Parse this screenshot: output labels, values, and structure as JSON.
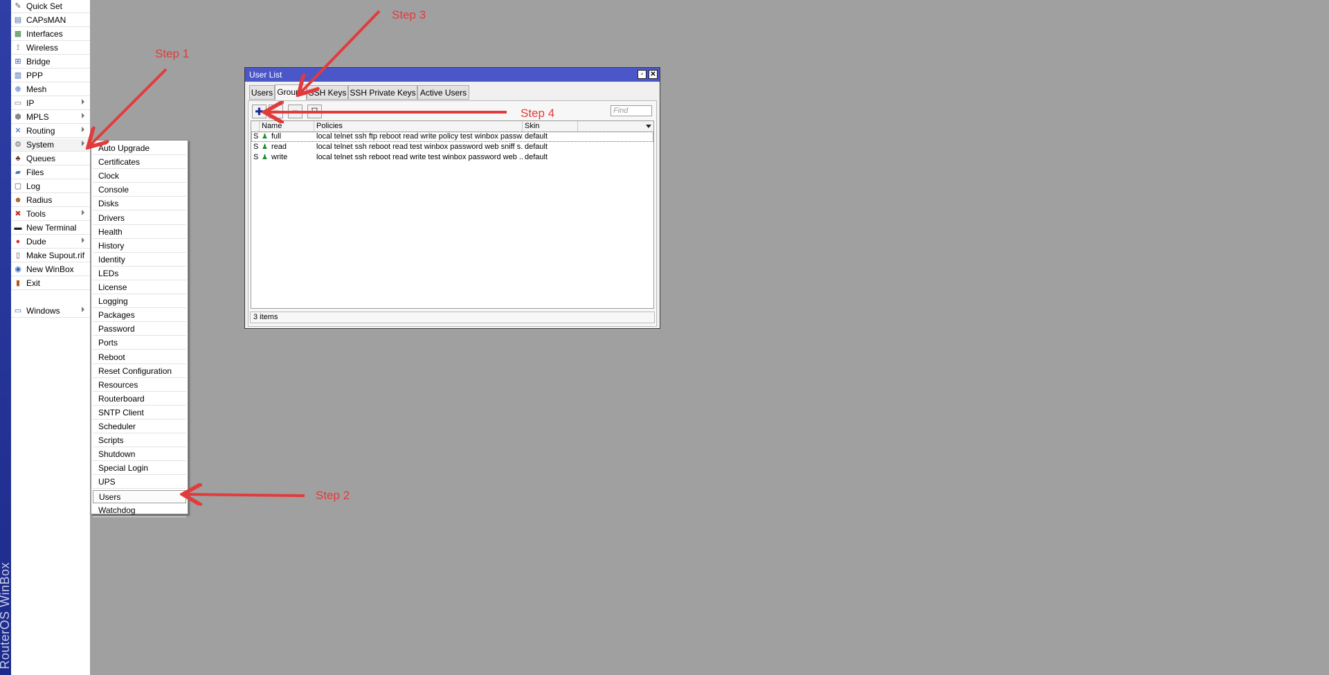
{
  "brand": "RouterOS WinBox",
  "side_menu": [
    {
      "label": "Quick Set",
      "icon": "magic-wand-icon",
      "glyph": "✎",
      "color": "#555",
      "arrow": false
    },
    {
      "label": "CAPsMAN",
      "icon": "capsman-icon",
      "glyph": "▤",
      "color": "#4a6aa8",
      "arrow": false
    },
    {
      "label": "Interfaces",
      "icon": "interfaces-icon",
      "glyph": "▦",
      "color": "#2d7a2d",
      "arrow": false
    },
    {
      "label": "Wireless",
      "icon": "wireless-icon",
      "glyph": "⟟",
      "color": "#555",
      "arrow": false
    },
    {
      "label": "Bridge",
      "icon": "bridge-icon",
      "glyph": "⊞",
      "color": "#2f5fb0",
      "arrow": false
    },
    {
      "label": "PPP",
      "icon": "ppp-icon",
      "glyph": "▥",
      "color": "#2f5fb0",
      "arrow": false
    },
    {
      "label": "Mesh",
      "icon": "mesh-icon",
      "glyph": "⊕",
      "color": "#2f5fb0",
      "arrow": false
    },
    {
      "label": "IP",
      "icon": "ip-icon",
      "glyph": "▭",
      "color": "#777",
      "arrow": true
    },
    {
      "label": "MPLS",
      "icon": "mpls-icon",
      "glyph": "⬢",
      "color": "#888",
      "arrow": true
    },
    {
      "label": "Routing",
      "icon": "routing-icon",
      "glyph": "✕",
      "color": "#2f5fb0",
      "arrow": true
    },
    {
      "label": "System",
      "icon": "system-gear-icon",
      "glyph": "⚙",
      "color": "#666",
      "arrow": true
    },
    {
      "label": "Queues",
      "icon": "queues-icon",
      "glyph": "♣",
      "color": "#5a3b2a",
      "arrow": false
    },
    {
      "label": "Files",
      "icon": "files-folder-icon",
      "glyph": "▰",
      "color": "#4a78c0",
      "arrow": false
    },
    {
      "label": "Log",
      "icon": "log-icon",
      "glyph": "▢",
      "color": "#555",
      "arrow": false
    },
    {
      "label": "Radius",
      "icon": "radius-users-icon",
      "glyph": "☻",
      "color": "#a06020",
      "arrow": false
    },
    {
      "label": "Tools",
      "icon": "tools-icon",
      "glyph": "✖",
      "color": "#c03030",
      "arrow": true
    },
    {
      "label": "New Terminal",
      "icon": "terminal-icon",
      "glyph": "▬",
      "color": "#222",
      "arrow": false
    },
    {
      "label": "Dude",
      "icon": "dude-icon",
      "glyph": "●",
      "color": "#d03030",
      "arrow": true
    },
    {
      "label": "Make Supout.rif",
      "icon": "supout-file-icon",
      "glyph": "▯",
      "color": "#555",
      "arrow": false
    },
    {
      "label": "New WinBox",
      "icon": "winbox-globe-icon",
      "glyph": "◉",
      "color": "#2f5fb0",
      "arrow": false
    },
    {
      "label": "Exit",
      "icon": "exit-door-icon",
      "glyph": "▮",
      "color": "#b05a1a",
      "arrow": false
    },
    {
      "label": "",
      "icon": "",
      "glyph": "",
      "color": "#000",
      "arrow": false,
      "spacer": true
    },
    {
      "label": "Windows",
      "icon": "windows-icon",
      "glyph": "▭",
      "color": "#2f5fb0",
      "arrow": true
    }
  ],
  "submenu": [
    "Auto Upgrade",
    "Certificates",
    "Clock",
    "Console",
    "Disks",
    "Drivers",
    "Health",
    "History",
    "Identity",
    "LEDs",
    "License",
    "Logging",
    "Packages",
    "Password",
    "Ports",
    "Reboot",
    "Reset Configuration",
    "Resources",
    "Routerboard",
    "SNTP Client",
    "Scheduler",
    "Scripts",
    "Shutdown",
    "Special Login",
    "UPS",
    "Users",
    "Watchdog"
  ],
  "window": {
    "title": "User List",
    "tabs": [
      "Users",
      "Groups",
      "SSH Keys",
      "SSH Private Keys",
      "Active Users"
    ],
    "active_tab": "Groups",
    "find_placeholder": "Find",
    "columns": {
      "name": "Name",
      "policies": "Policies",
      "skin": "Skin"
    },
    "rows": [
      {
        "flag": "S",
        "name": "full",
        "policies": "local telnet ssh ftp reboot read write policy test winbox passw...",
        "skin": "default"
      },
      {
        "flag": "S",
        "name": "read",
        "policies": "local telnet ssh reboot read test winbox password web sniff s...",
        "skin": "default"
      },
      {
        "flag": "S",
        "name": "write",
        "policies": "local telnet ssh reboot read write test winbox password web ...",
        "skin": "default"
      }
    ],
    "status": "3 items"
  },
  "annotations": [
    "Step 1",
    "Step 2",
    "Step 3",
    "Step 4"
  ],
  "accent_color": "#e23b3b"
}
